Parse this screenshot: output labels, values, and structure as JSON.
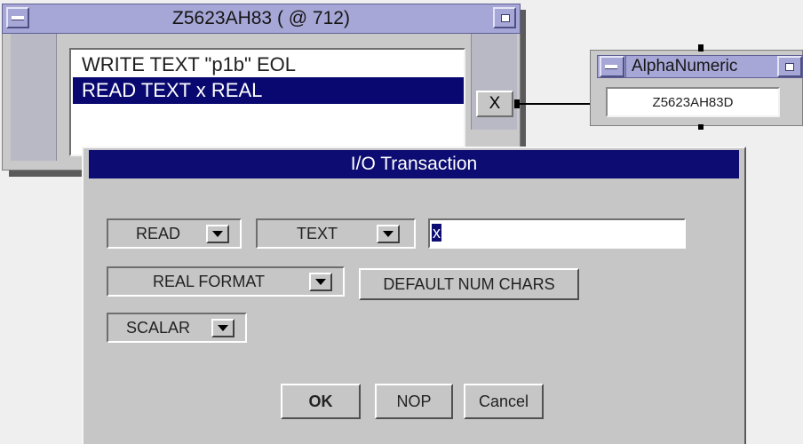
{
  "transaction_object": {
    "title": "Z5623AH83 ( @ 712)",
    "transactions": [
      {
        "text": "WRITE TEXT \"p1b\" EOL",
        "selected": false
      },
      {
        "text": "READ TEXT x REAL",
        "selected": true
      }
    ],
    "output_terminal": "X"
  },
  "alphanumeric": {
    "title": "AlphaNumeric",
    "value": "Z5623AH83D"
  },
  "dialog": {
    "title": "I/O Transaction",
    "action": "READ",
    "encoding": "TEXT",
    "variable": "x",
    "format": "REAL FORMAT",
    "num_chars": "DEFAULT NUM CHARS",
    "shape": "SCALAR",
    "ok_label": "OK",
    "nop_label": "NOP",
    "cancel_label": "Cancel"
  },
  "colors": {
    "title_bar": "#a6a7d6",
    "dialog_title": "#0c0c72",
    "selection": "#080870",
    "panel": "#c6c6c6"
  },
  "icons": [
    "minimize-icon",
    "maximize-icon",
    "dropdown-arrow-icon"
  ]
}
